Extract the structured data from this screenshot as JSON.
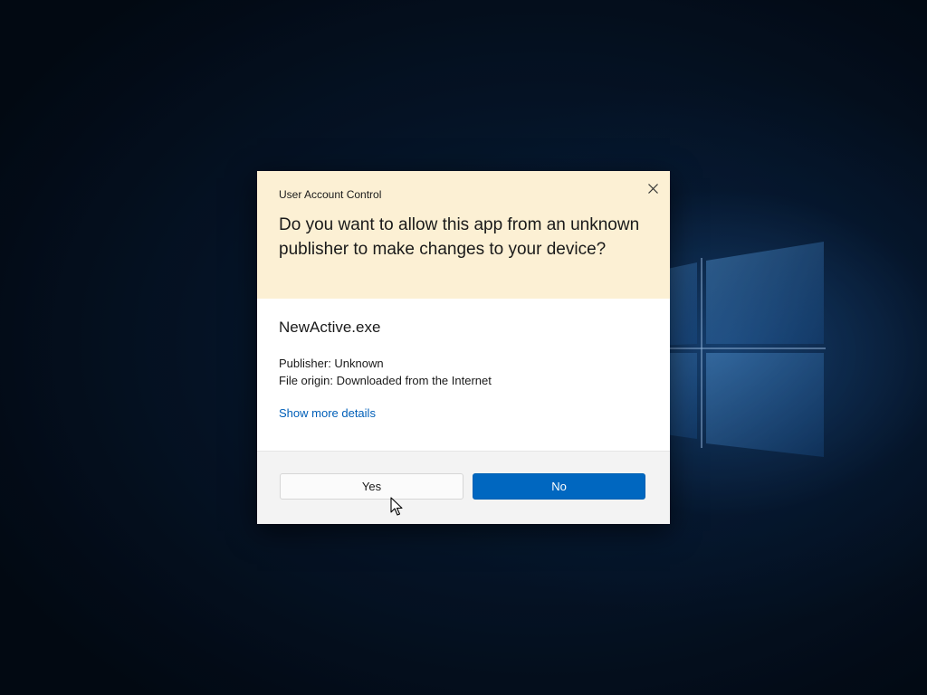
{
  "dialog": {
    "title": "User Account Control",
    "question": "Do you want to allow this app from an unknown publisher to make changes to your device?",
    "app_name": "NewActive.exe",
    "publisher": "Publisher: Unknown",
    "file_origin": "File origin: Downloaded from the Internet",
    "details_link": "Show more details",
    "yes_label": "Yes",
    "no_label": "No",
    "close_icon": "close-icon"
  },
  "colors": {
    "header_background": "#fcf0d4",
    "primary_button": "#0067c0",
    "link": "#005fb8",
    "footer_background": "#f3f3f3"
  }
}
